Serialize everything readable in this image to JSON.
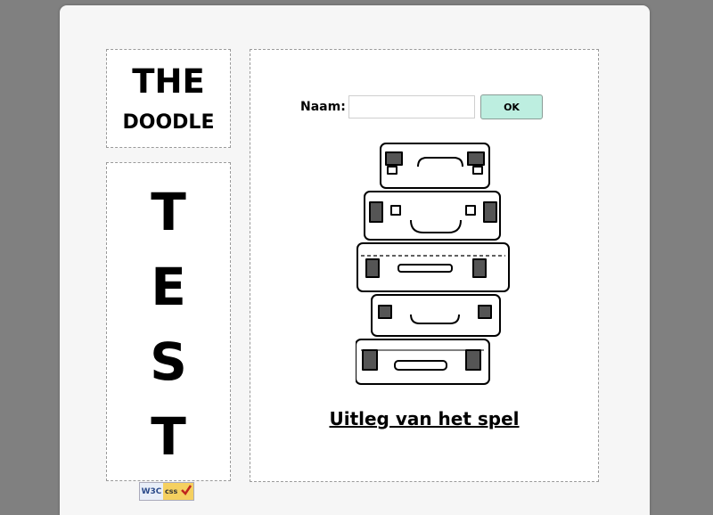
{
  "sidebar": {
    "title_line1": "THE",
    "title_line2": "DOODLE",
    "test_letters": [
      "T",
      "E",
      "S",
      "T"
    ]
  },
  "form": {
    "name_label": "Naam:",
    "name_value": "",
    "ok_label": "OK"
  },
  "main": {
    "instructions_link": "Uitleg van het spel",
    "image": "suitcases-stack-illustration"
  },
  "badge": {
    "left_text": "W3C",
    "right_text": "css"
  },
  "colors": {
    "backdrop": "#808080",
    "panel": "#f6f6f6",
    "ok_button": "#bdeee0"
  }
}
